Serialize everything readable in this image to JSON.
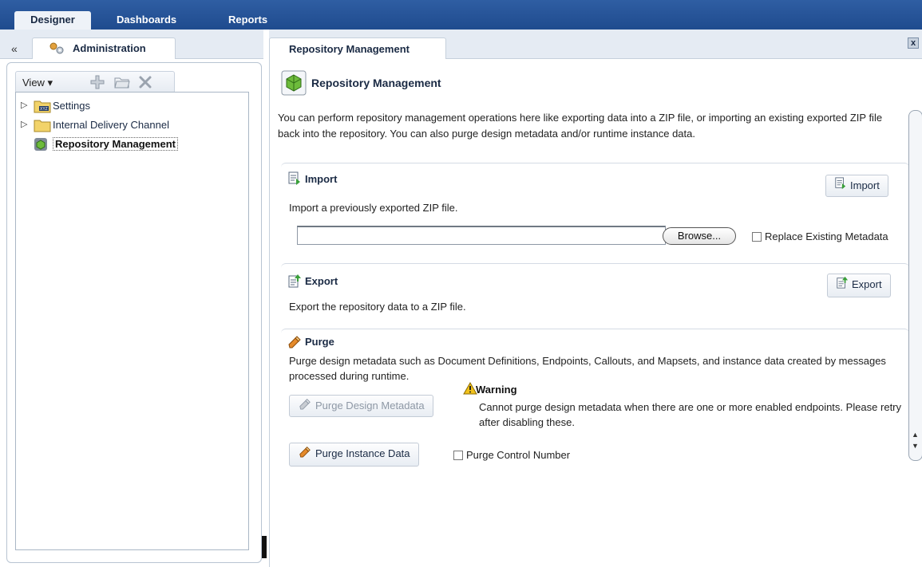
{
  "top_tabs": [
    {
      "label": "Designer",
      "active": true
    },
    {
      "label": "Dashboards",
      "active": false
    },
    {
      "label": "Reports",
      "active": false
    }
  ],
  "left": {
    "collapse_glyph": "«",
    "tab_label": "Administration",
    "toolbar": {
      "view_label": "View ▾"
    },
    "tree": [
      {
        "label": "Settings",
        "icon": "settings-folder-icon",
        "expander": "▷"
      },
      {
        "label": "Internal Delivery Channel",
        "icon": "folder-icon",
        "expander": "▷"
      },
      {
        "label": "Repository Management",
        "icon": "repository-icon",
        "selected": true
      }
    ]
  },
  "right": {
    "tab_label": "Repository Management",
    "close_glyph": "x",
    "header_title": "Repository Management",
    "intro": "You can perform repository management operations here like exporting data into a ZIP file, or importing an existing exported ZIP file back into the repository.  You can also purge design metadata and/or runtime instance data.",
    "import": {
      "title": "Import",
      "description": "Import a previously exported ZIP file.",
      "button": "Import",
      "browse": "Browse...",
      "file_value": "",
      "replace_label": "Replace Existing Metadata"
    },
    "export": {
      "title": "Export",
      "description": "Export the repository data to a ZIP file.",
      "button": "Export"
    },
    "purge": {
      "title": "Purge",
      "description": "Purge design metadata such as Document Definitions, Endpoints, Callouts, and Mapsets, and instance data created by messages processed during runtime.",
      "design_button": "Purge Design Metadata",
      "warning_title": "Warning",
      "warning_text": "Cannot purge design metadata when there are one or more enabled endpoints. Please retry after disabling these.",
      "instance_button": "Purge Instance Data",
      "control_number_label": "Purge Control Number"
    }
  },
  "colors": {
    "top_bar": "#2f5ea3",
    "panel_bg": "#e5ebf3",
    "border": "#c6d0dc",
    "heading_text": "#1a2a44"
  }
}
